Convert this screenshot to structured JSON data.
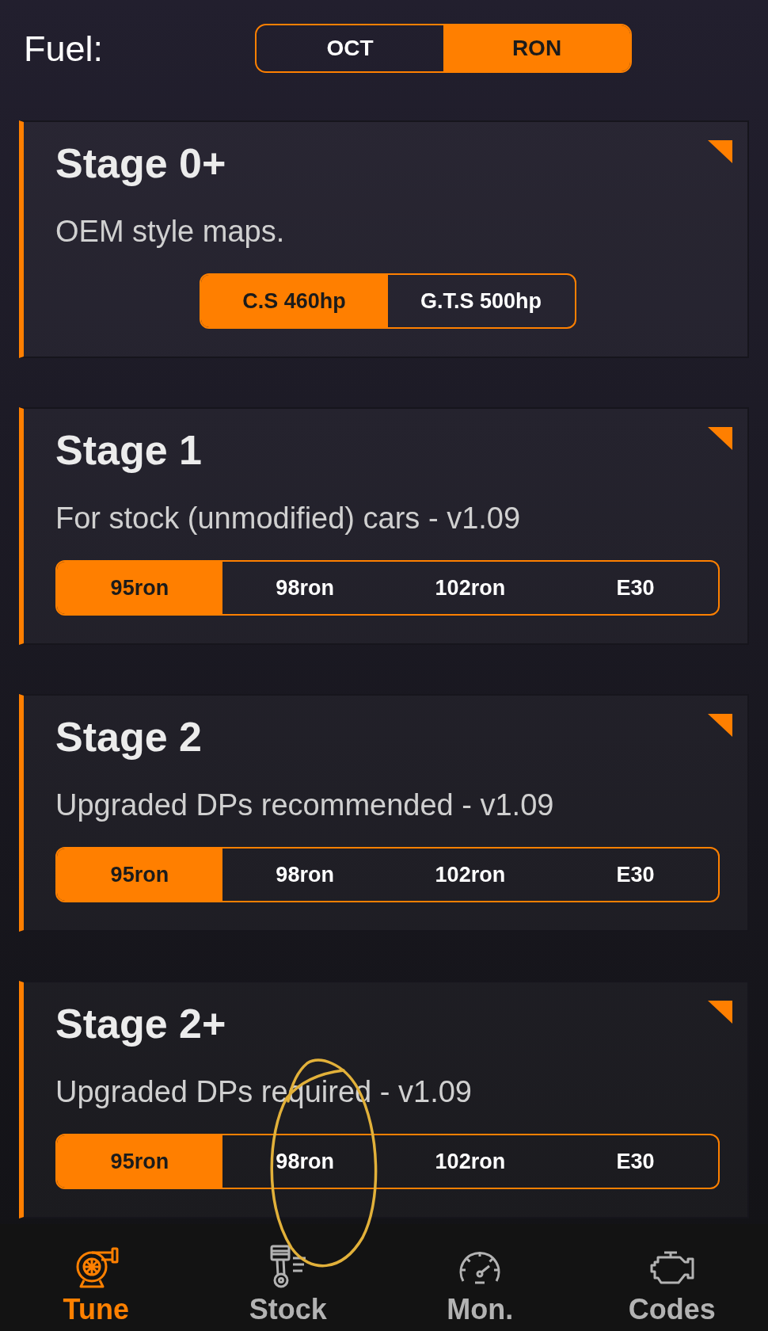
{
  "fuel": {
    "label": "Fuel:",
    "options": [
      {
        "label": "OCT",
        "selected": false
      },
      {
        "label": "RON",
        "selected": true
      }
    ]
  },
  "stages": [
    {
      "title": "Stage 0+",
      "description": "OEM style maps.",
      "options": [
        {
          "label": "C.S 460hp",
          "selected": true,
          "circled": false
        },
        {
          "label": "G.T.S 500hp",
          "selected": false,
          "circled": false
        }
      ]
    },
    {
      "title": "Stage 1",
      "description": "For stock (unmodified) cars - v1.09",
      "options": [
        {
          "label": "95ron",
          "selected": true,
          "circled": false
        },
        {
          "label": "98ron",
          "selected": false,
          "circled": false
        },
        {
          "label": "102ron",
          "selected": false,
          "circled": false
        },
        {
          "label": "E30",
          "selected": false,
          "circled": false
        }
      ]
    },
    {
      "title": "Stage 2",
      "description": "Upgraded DPs recommended - v1.09",
      "options": [
        {
          "label": "95ron",
          "selected": true,
          "circled": false
        },
        {
          "label": "98ron",
          "selected": false,
          "circled": false
        },
        {
          "label": "102ron",
          "selected": false,
          "circled": false
        },
        {
          "label": "E30",
          "selected": false,
          "circled": false
        }
      ]
    },
    {
      "title": "Stage 2+",
      "description": "Upgraded DPs required - v1.09",
      "options": [
        {
          "label": "95ron",
          "selected": true,
          "circled": false
        },
        {
          "label": "98ron",
          "selected": false,
          "circled": true
        },
        {
          "label": "102ron",
          "selected": false,
          "circled": false
        },
        {
          "label": "E30",
          "selected": false,
          "circled": false
        }
      ]
    }
  ],
  "nav": [
    {
      "label": "Tune",
      "selected": true
    },
    {
      "label": "Stock",
      "selected": false
    },
    {
      "label": "Mon.",
      "selected": false
    },
    {
      "label": "Codes",
      "selected": false
    }
  ]
}
